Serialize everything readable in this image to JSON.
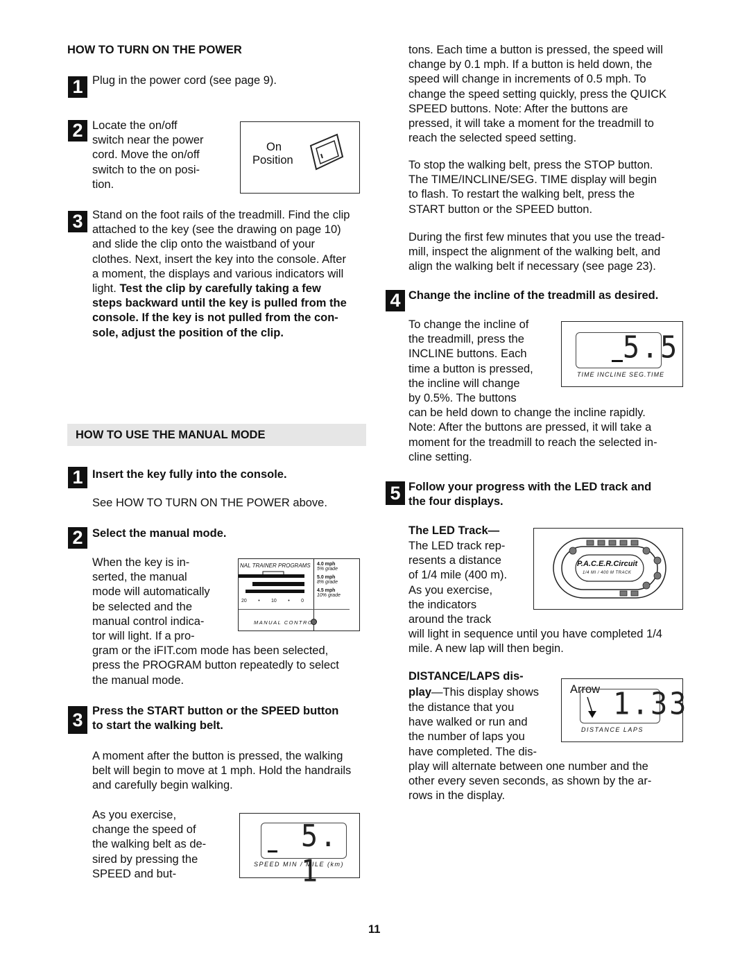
{
  "power": {
    "heading": "HOW TO TURN ON THE POWER",
    "step1": {
      "num": "1",
      "lines": [
        "Plug in the power cord (see page 9)."
      ]
    },
    "step2": {
      "num": "2",
      "lines": [
        "Locate the on/off",
        "switch near the power",
        "cord. Move the on/off",
        "switch to the on posi-",
        "tion."
      ],
      "figure_on": "On",
      "figure_position": "Position"
    },
    "step3": {
      "num": "3",
      "lines": [
        "Stand on the foot rails of the treadmill. Find the clip",
        "attached to the key (see the drawing on page 10)",
        "and slide the clip onto the waistband of your",
        "clothes. Next, insert the key into the console. After",
        "a moment, the displays and various indicators will",
        {
          "normal": "light. ",
          "bold": "Test the clip by carefully taking a few"
        },
        {
          "bold": "steps backward until the key is pulled from the"
        },
        {
          "bold": "console. If the key is not pulled from the con-"
        },
        {
          "bold": "sole, adjust the position of the clip."
        }
      ]
    }
  },
  "manual": {
    "heading": "HOW TO USE THE MANUAL MODE",
    "step1": {
      "num": "1",
      "title": "Insert the key fully into the console.",
      "lines": [
        "See HOW TO TURN ON THE POWER above."
      ]
    },
    "step2": {
      "num": "2",
      "title": "Select the manual mode.",
      "lines": [
        "When the key is in-",
        "serted, the manual",
        "mode will automatically",
        "be selected and the",
        "manual control indica-",
        "tor will light. If a pro-",
        "gram or the iFIT.com mode has been selected,",
        "press the PROGRAM button repeatedly to select",
        "the manual mode."
      ],
      "panel": {
        "title": "NAL TRAINER PROGRAMS",
        "programs": [
          {
            "speed": "4.0 mph",
            "grade": "5% grade"
          },
          {
            "speed": "5.0 mph",
            "grade": "8% grade"
          },
          {
            "speed": "4.5 mph",
            "grade": "10% grade"
          }
        ],
        "ticks": [
          "20",
          "•",
          "10",
          "•",
          "0"
        ],
        "manual_control": "MANUAL CONTROL"
      }
    },
    "step3": {
      "num": "3",
      "title_lines": [
        "Press the START button or the SPEED    button",
        "to start the walking belt."
      ],
      "lines": [
        "A moment after the button is pressed, the walking",
        "belt will begin to move at 1 mph. Hold the handrails",
        "and carefully begin walking."
      ],
      "lines2": [
        "As you exercise,",
        "change the speed of",
        "the walking belt as de-",
        "sired by pressing the",
        "SPEED    and    but-"
      ],
      "display": {
        "value": "5. 1",
        "labels": "SPEED   MIN / MILE (km)"
      }
    }
  },
  "right": {
    "p1": [
      "tons. Each time a button is pressed, the speed will",
      "change by 0.1 mph. If a button is held down, the",
      "speed will change in increments of 0.5 mph. To",
      "change the speed setting quickly, press the QUICK",
      "SPEED buttons. Note: After the buttons are",
      "pressed, it will take a moment for the treadmill to",
      "reach the selected speed setting."
    ],
    "p2": [
      "To stop the walking belt, press the STOP button.",
      "The TIME/INCLINE/SEG. TIME display will begin",
      "to flash. To restart the walking belt, press the",
      "START button or the SPEED    button."
    ],
    "p3": [
      "During the first few minutes that you use the tread-",
      "mill, inspect the alignment of the walking belt, and",
      "align the walking belt if necessary (see page 23)."
    ],
    "step4": {
      "num": "4",
      "title": "Change the incline of the treadmill as desired.",
      "lines": [
        "To change the incline of",
        "the treadmill, press the",
        "INCLINE buttons. Each",
        "time a button is pressed,",
        "the incline will change",
        "by 0.5%. The buttons",
        "can be held down to change the incline rapidly.",
        "Note: After the buttons are pressed, it will take a",
        "moment for the treadmill to reach the selected in-",
        "cline setting."
      ],
      "display": {
        "value": "5.5",
        "labels": "TIME  INCLINE  SEG.TIME"
      }
    },
    "step5": {
      "num": "5",
      "title_lines": [
        "Follow your progress with the LED track and",
        "the four displays."
      ],
      "led_title": "The LED Track—",
      "led_lines": [
        "The LED track rep-",
        "resents a distance",
        "of 1/4 mile (400 m).",
        "As you exercise,",
        "the indicators",
        "around the track",
        "will light in sequence until you have completed 1/4",
        "mile. A new lap will then begin."
      ],
      "track": {
        "logo": "P.A.C.E.R.Circuit",
        "caption": "1/4 MI  /  400 M  TRACK"
      },
      "dist_title": "DISTANCE/LAPS dis-",
      "dist_title2": "play",
      "dist_lines": [
        "—This display shows",
        "the distance that you",
        "have walked or run and",
        "the number of laps you",
        "have completed. The dis-",
        "play will alternate between one number and the",
        "other every seven seconds, as shown by the ar-",
        "rows in the display."
      ],
      "dist_display": {
        "arrow_label": "Arrow",
        "value": "1.33",
        "labels": "DISTANCE      LAPS"
      }
    }
  },
  "page_number": "11"
}
